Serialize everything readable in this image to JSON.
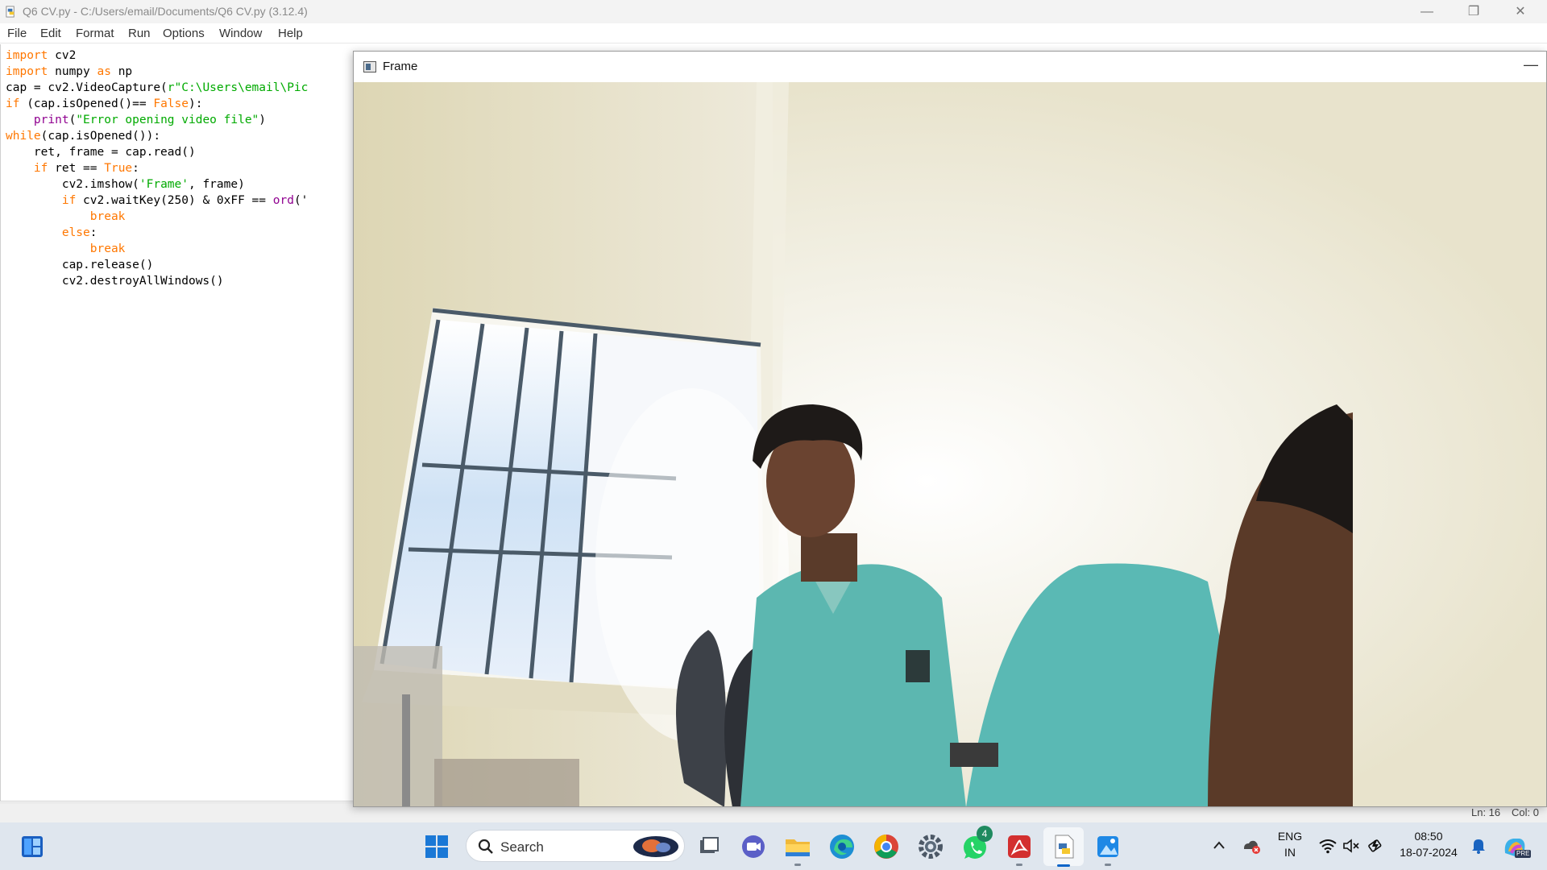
{
  "window": {
    "title": "Q6 CV.py - C:/Users/email/Documents/Q6 CV.py (3.12.4)",
    "minimize_glyph": "—",
    "restore_glyph": "❐",
    "close_glyph": "✕"
  },
  "menu": [
    "File",
    "Edit",
    "Format",
    "Run",
    "Options",
    "Window",
    "Help"
  ],
  "code": [
    [
      {
        "t": "import",
        "c": "kw"
      },
      {
        "t": " cv2",
        "c": ""
      }
    ],
    [
      {
        "t": "import",
        "c": "kw"
      },
      {
        "t": " numpy ",
        "c": ""
      },
      {
        "t": "as",
        "c": "kw"
      },
      {
        "t": " np",
        "c": ""
      }
    ],
    [
      {
        "t": "cap = cv2.VideoCapture(",
        "c": ""
      },
      {
        "t": "r\"C:\\Users\\email\\Pic",
        "c": "str"
      }
    ],
    [
      {
        "t": "if",
        "c": "kw"
      },
      {
        "t": " (cap.isOpened()== ",
        "c": ""
      },
      {
        "t": "False",
        "c": "kw"
      },
      {
        "t": "):",
        "c": ""
      }
    ],
    [
      {
        "t": "    ",
        "c": ""
      },
      {
        "t": "print",
        "c": "bi"
      },
      {
        "t": "(",
        "c": ""
      },
      {
        "t": "\"Error opening video file\"",
        "c": "str"
      },
      {
        "t": ")",
        "c": ""
      }
    ],
    [
      {
        "t": "while",
        "c": "kw"
      },
      {
        "t": "(cap.isOpened()):",
        "c": ""
      }
    ],
    [
      {
        "t": "    ret, frame = cap.read()",
        "c": ""
      }
    ],
    [
      {
        "t": "    ",
        "c": ""
      },
      {
        "t": "if",
        "c": "kw"
      },
      {
        "t": " ret == ",
        "c": ""
      },
      {
        "t": "True",
        "c": "kw"
      },
      {
        "t": ":",
        "c": ""
      }
    ],
    [
      {
        "t": "        cv2.imshow(",
        "c": ""
      },
      {
        "t": "'Frame'",
        "c": "str"
      },
      {
        "t": ", frame)",
        "c": ""
      }
    ],
    [
      {
        "t": "        ",
        "c": ""
      },
      {
        "t": "if",
        "c": "kw"
      },
      {
        "t": " cv2.waitKey(250) & 0xFF == ",
        "c": ""
      },
      {
        "t": "ord",
        "c": "bi"
      },
      {
        "t": "('",
        "c": ""
      }
    ],
    [
      {
        "t": "            ",
        "c": ""
      },
      {
        "t": "break",
        "c": "kw"
      }
    ],
    [
      {
        "t": "        ",
        "c": ""
      },
      {
        "t": "else",
        "c": "kw"
      },
      {
        "t": ":",
        "c": ""
      }
    ],
    [
      {
        "t": "            ",
        "c": ""
      },
      {
        "t": "break",
        "c": "kw"
      }
    ],
    [
      {
        "t": "        cap.release()",
        "c": ""
      }
    ],
    [
      {
        "t": "        cv2.destroyAllWindows()",
        "c": ""
      }
    ]
  ],
  "status": {
    "line": "Ln: 16",
    "col": "Col: 0"
  },
  "frame_window": {
    "title": "Frame",
    "minimize_glyph": "—"
  },
  "taskbar": {
    "search_label": "Search",
    "whatsapp_badge": "4",
    "lang_top": "ENG",
    "lang_bottom": "IN",
    "time": "08:50",
    "date": "18-07-2024",
    "copilot_badge": "PRE"
  }
}
